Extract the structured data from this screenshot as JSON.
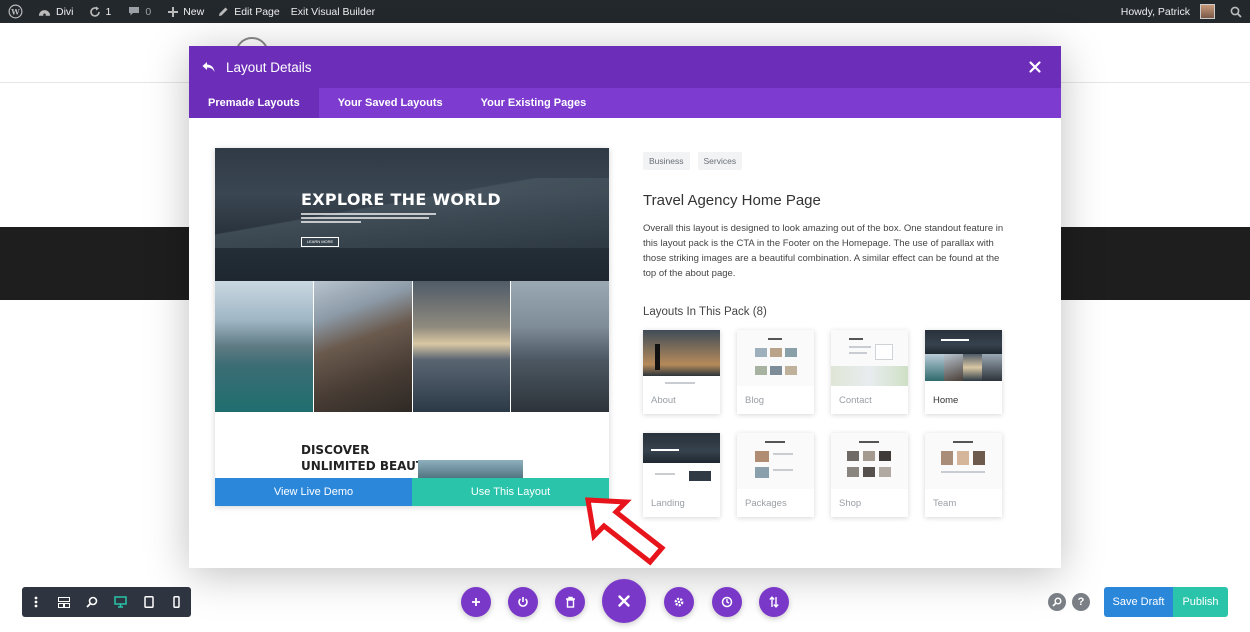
{
  "adminbar": {
    "site_name": "Divi",
    "updates_count": "1",
    "comments_count": "0",
    "new_label": "New",
    "edit_page_label": "Edit Page",
    "exit_vb_label": "Exit Visual Builder",
    "greeting": "Howdy, Patrick"
  },
  "modal": {
    "title": "Layout Details",
    "tabs": [
      {
        "label": "Premade Layouts",
        "active": true
      },
      {
        "label": "Your Saved Layouts",
        "active": false
      },
      {
        "label": "Your Existing Pages",
        "active": false
      }
    ],
    "preview": {
      "hero_heading": "EXPLORE THE WORLD",
      "hero_button": "LEARN MORE",
      "section_heading_line1": "DISCOVER",
      "section_heading_line2": "UNLIMITED BEAUTY"
    },
    "view_demo_label": "View Live Demo",
    "use_layout_label": "Use This Layout",
    "tags": [
      "Business",
      "Services"
    ],
    "layout_title": "Travel Agency Home Page",
    "description": "Overall this layout is designed to look amazing out of the box. One standout feature in this layout pack is the CTA in the Footer on the Homepage. The use of parallax with those striking images are a beautiful combination. A similar effect can be found at the top of the about page.",
    "pack_title": "Layouts In This Pack (8)",
    "layouts": [
      {
        "label": "About",
        "current": false
      },
      {
        "label": "Blog",
        "current": false
      },
      {
        "label": "Contact",
        "current": false
      },
      {
        "label": "Home",
        "current": true
      },
      {
        "label": "Landing",
        "current": false
      },
      {
        "label": "Packages",
        "current": false
      },
      {
        "label": "Shop",
        "current": false
      },
      {
        "label": "Team",
        "current": false
      }
    ]
  },
  "footer": {
    "save_draft_label": "Save Draft",
    "publish_label": "Publish"
  },
  "colors": {
    "modal_header": "#6c2eb9",
    "tabs_bar": "#7e3bd0",
    "blue": "#2b87da",
    "teal": "#29c4a9",
    "annotation_arrow": "#e8141b"
  }
}
